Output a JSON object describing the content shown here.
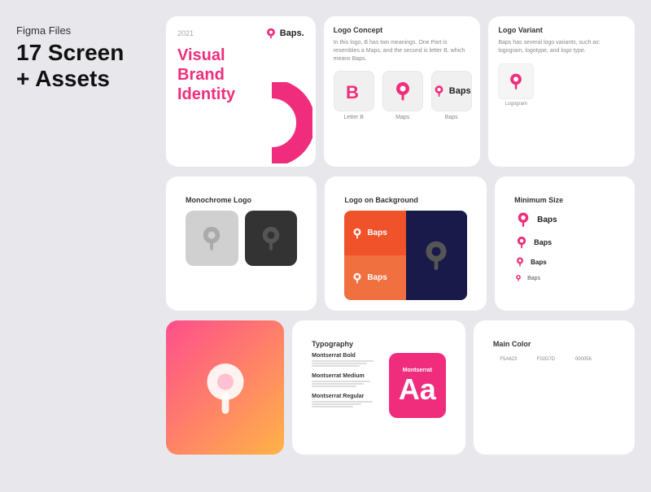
{
  "page": {
    "background": "#e8e8ec",
    "title_sub": "Figma Files",
    "title_main": "17 Screen\n+ Assets"
  },
  "cards": {
    "brand": {
      "year": "2021",
      "logo_name": "Baps.",
      "title": "Visual\nBrand\nIdentity"
    },
    "logo_concept": {
      "title": "Logo Concept",
      "desc": "In this logo, B has two meanings. One Part is resembles a Maps, and the second is letter B, which means Baps.",
      "items": [
        {
          "label": "Letter B"
        },
        {
          "label": "Maps"
        },
        {
          "label": "Baps"
        }
      ]
    },
    "logo_variant": {
      "title": "Logo Variant",
      "desc": "Baps has several logo variants, such as: logogram, logotype, and logo type.",
      "sub": "Logogram"
    },
    "monochrome": {
      "title": "Monochrome Logo"
    },
    "logo_bg": {
      "title": "Logo on Background",
      "logo_text": "Baps"
    },
    "min_size": {
      "title": "Minimum Size",
      "items": [
        {
          "size": "large"
        },
        {
          "size": "medium"
        },
        {
          "size": "small"
        },
        {
          "size": "xsmall"
        }
      ]
    },
    "typography": {
      "title": "Typography",
      "fonts": [
        {
          "name": "Montserrat Bold"
        },
        {
          "name": "Montserrat Medium"
        },
        {
          "name": "Montserrat Regular"
        }
      ],
      "preview": "Montserrat",
      "sample": "Aa"
    },
    "colors": {
      "title": "Main Color",
      "swatches": [
        {
          "top": "#f5a623",
          "bottom": "#e8e8e8",
          "label": "F5A623"
        },
        {
          "top": "#f02d7d",
          "bottom": "#e8e8e8",
          "label": "F02D7D"
        },
        {
          "top": "#1a1a5e",
          "bottom": "#e8e8e8",
          "label": "000056"
        }
      ]
    }
  }
}
